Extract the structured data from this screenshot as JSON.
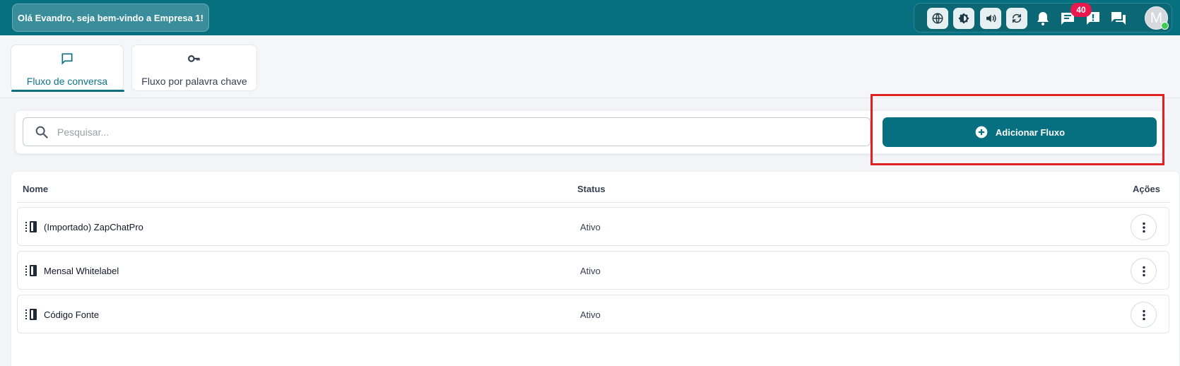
{
  "header": {
    "welcome": "Olá Evandro, seja bem-vindo a Empresa 1!",
    "icons": [
      "globe-icon",
      "brightness-icon",
      "volume-icon",
      "refresh-icon",
      "bell-icon",
      "chat-icon",
      "alert-icon",
      "forum-icon"
    ],
    "badge_count": "40",
    "avatar_initial": "M"
  },
  "tabs": [
    {
      "label": "Fluxo de conversa",
      "icon": "chat-bubble-icon",
      "active": true
    },
    {
      "label": "Fluxo por palavra chave",
      "icon": "key-icon",
      "active": false
    }
  ],
  "search": {
    "placeholder": "Pesquisar...",
    "value": ""
  },
  "add_button": {
    "label": "Adicionar Fluxo"
  },
  "table": {
    "headers": {
      "name": "Nome",
      "status": "Status",
      "actions": "Ações"
    },
    "rows": [
      {
        "name": "(Importado) ZapChatPro",
        "status": "Ativo"
      },
      {
        "name": "Mensal Whitelabel",
        "status": "Ativo"
      },
      {
        "name": "Código Fonte",
        "status": "Ativo"
      }
    ]
  },
  "colors": {
    "primary": "#066f80",
    "badge": "#e8194f",
    "highlight": "#e01f1f",
    "online": "#3ecb52"
  }
}
